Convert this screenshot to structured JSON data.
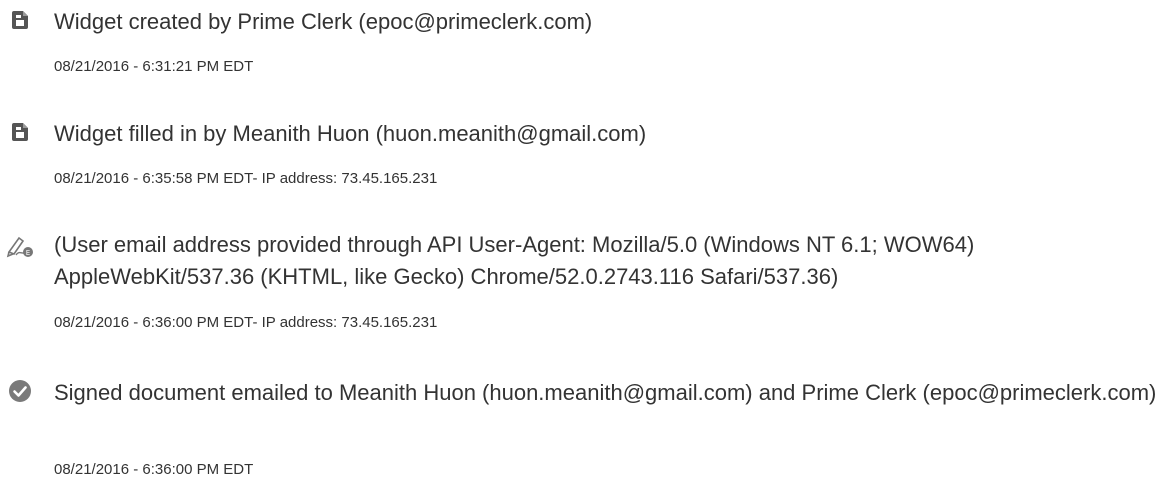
{
  "events": [
    {
      "icon": "document-copy-icon",
      "title": "Widget created by Prime Clerk (epoc@primeclerk.com)",
      "timestamp": "08/21/2016 - 6:31:21 PM EDT"
    },
    {
      "icon": "document-copy-icon",
      "title": "Widget filled in by Meanith Huon (huon.meanith@gmail.com)",
      "timestamp": "08/21/2016 - 6:35:58 PM EDT- IP address: 73.45.165.231"
    },
    {
      "icon": "signature-pen-icon",
      "title": "(User email address provided through API User-Agent: Mozilla/5.0 (Windows NT 6.1; WOW64) AppleWebKit/537.36 (KHTML, like Gecko) Chrome/52.0.2743.116 Safari/537.36)",
      "timestamp": "08/21/2016 - 6:36:00 PM EDT- IP address: 73.45.165.231"
    },
    {
      "icon": "check-circle-icon",
      "title": "Signed document emailed to Meanith Huon (huon.meanith@gmail.com) and Prime Clerk (epoc@primeclerk.com)",
      "timestamp": "08/21/2016 - 6:36:00 PM EDT"
    }
  ],
  "colors": {
    "text": "#333333",
    "icon": "#555555",
    "check_circle": "#7a7a7a"
  }
}
